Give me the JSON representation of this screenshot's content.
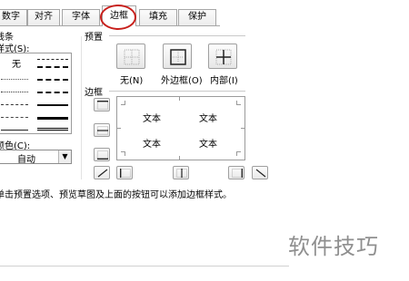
{
  "tabs": [
    {
      "label": "数字"
    },
    {
      "label": "对齐"
    },
    {
      "label": "字体"
    },
    {
      "label": "边框",
      "active": true
    },
    {
      "label": "填充"
    },
    {
      "label": "保护"
    }
  ],
  "line_section": {
    "title": "线条",
    "style_label": "样式(S):",
    "none_label": "无"
  },
  "color": {
    "label": "颜色(C):",
    "value": "自动"
  },
  "presets": {
    "title": "预置",
    "buttons": [
      {
        "label": "无(N)"
      },
      {
        "label": "外边框(O)"
      },
      {
        "label": "内部(I)"
      }
    ]
  },
  "border": {
    "title": "边框",
    "preview_texts": [
      "文本",
      "文本",
      "文本",
      "文本"
    ]
  },
  "hint": "单击预置选项、预览草图及上面的按钮可以添加边框样式。",
  "watermark": "软件技巧",
  "colors": {
    "highlight_circle": "#c8201c"
  }
}
